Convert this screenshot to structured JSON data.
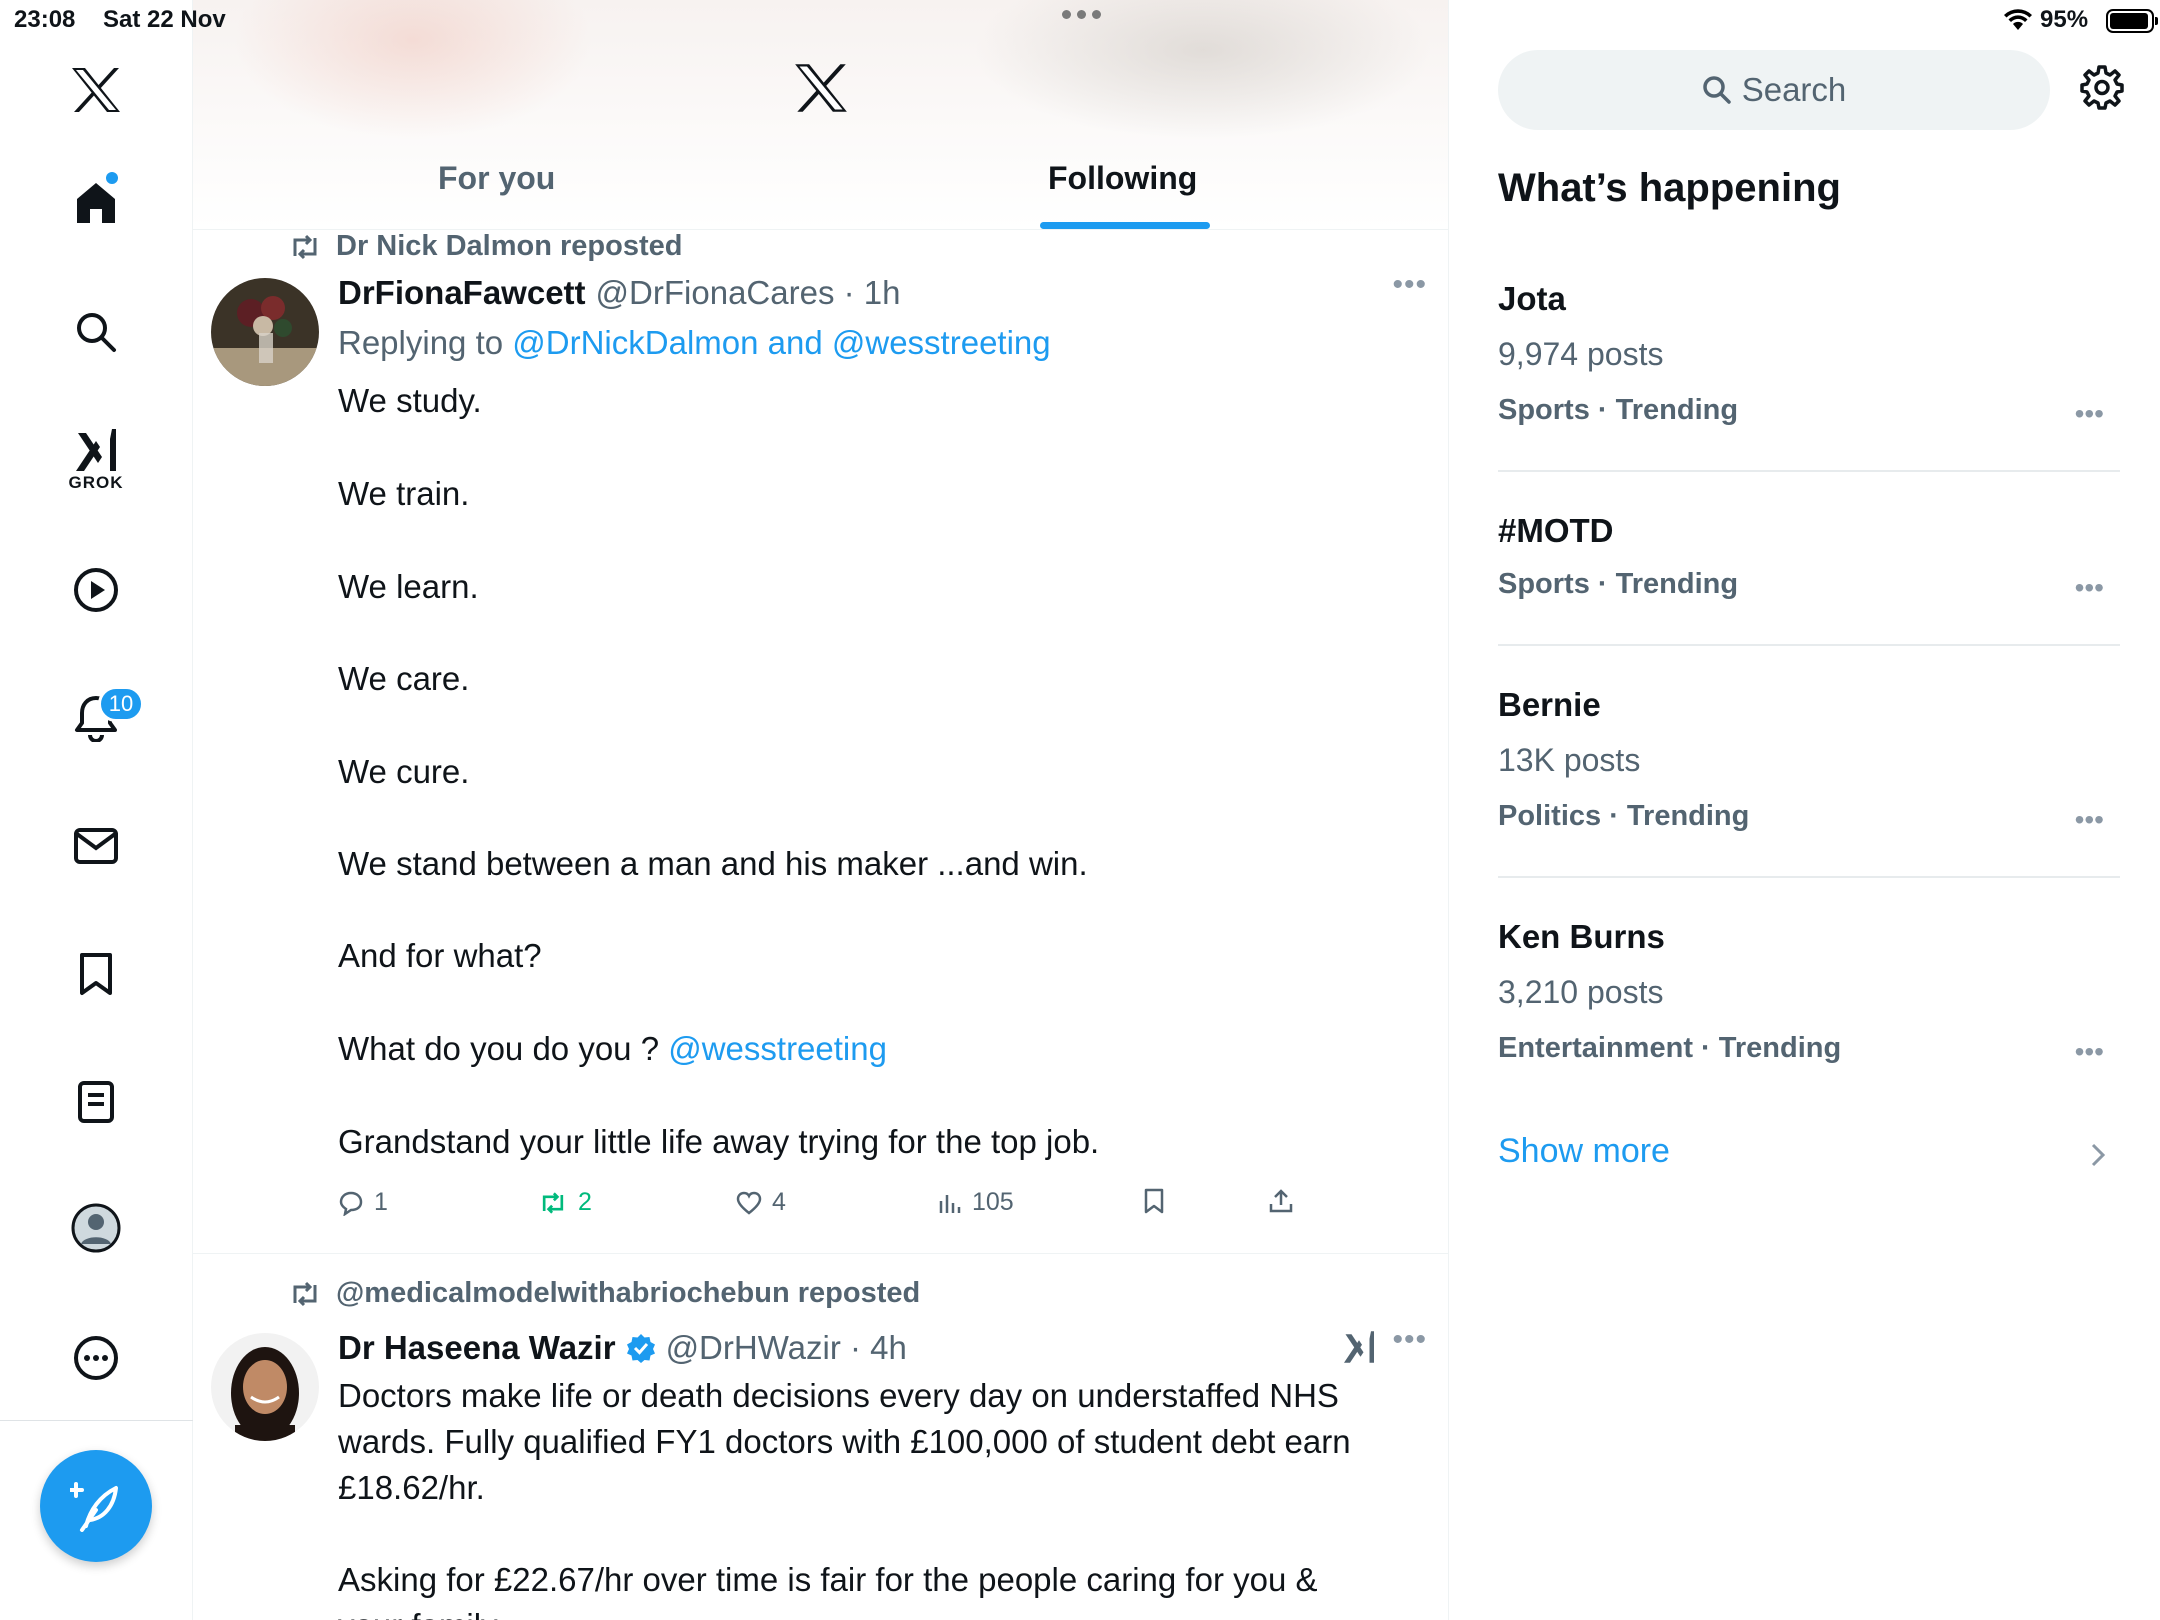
{
  "status_bar": {
    "time": "23:08",
    "date": "Sat 22 Nov",
    "battery": "95%"
  },
  "nav": {
    "grok_label": "GROK",
    "notifications_badge": "10",
    "items": [
      "home-icon",
      "search-icon",
      "grok-icon",
      "video-icon",
      "notifications-icon",
      "messages-icon",
      "bookmarks-icon",
      "lists-icon",
      "profile-icon",
      "more-icon"
    ]
  },
  "timeline": {
    "tabs": [
      {
        "label": "For you"
      },
      {
        "label": "Following"
      }
    ],
    "active_tab": "Following",
    "posts": [
      {
        "repost_by": "Dr Nick Dalmon reposted",
        "name": "DrFionaFawcett",
        "handle": "@DrFionaCares · 1h",
        "replying_prefix": "Replying to",
        "replying_to": "@DrNickDalmon and @wesstreeting",
        "lines": [
          "We study.",
          "We train.",
          "We learn.",
          "We care.",
          "We cure.",
          "We stand between a man and his maker ...and win.",
          "And for what?",
          "What do you do you ?",
          "Grandstand your little life away trying for the top job."
        ],
        "mention": "@wesstreeting",
        "replies": "1",
        "reposts": "2",
        "likes": "4",
        "views": "105"
      },
      {
        "repost_by": "@medicalmodelwithabriochebun reposted",
        "name": "Dr Haseena Wazir",
        "handle": "@DrHWazir · 4h",
        "lines": [
          "Doctors make life or death decisions every day on understaffed NHS",
          "wards. Fully qualified FY1 doctors with £100,000 of student debt earn",
          "£18.62/hr.",
          "Asking for £22.67/hr over time is fair for the people caring for you &",
          "your family."
        ]
      }
    ]
  },
  "sidebar": {
    "search_placeholder": "Search",
    "title": "What’s happening",
    "trends": [
      {
        "name": "Jota",
        "posts": "9,974 posts",
        "meta": "Sports · Trending"
      },
      {
        "name": "#MOTD",
        "posts": "",
        "meta": "Sports · Trending"
      },
      {
        "name": "Bernie",
        "posts": "13K posts",
        "meta": "Politics · Trending"
      },
      {
        "name": "Ken Burns",
        "posts": "3,210 posts",
        "meta": "Entertainment · Trending"
      }
    ],
    "show_more": "Show more"
  },
  "colors": {
    "accent": "#1d9bf0",
    "repost_green": "#00ba7c",
    "secondary_text": "#536471"
  }
}
